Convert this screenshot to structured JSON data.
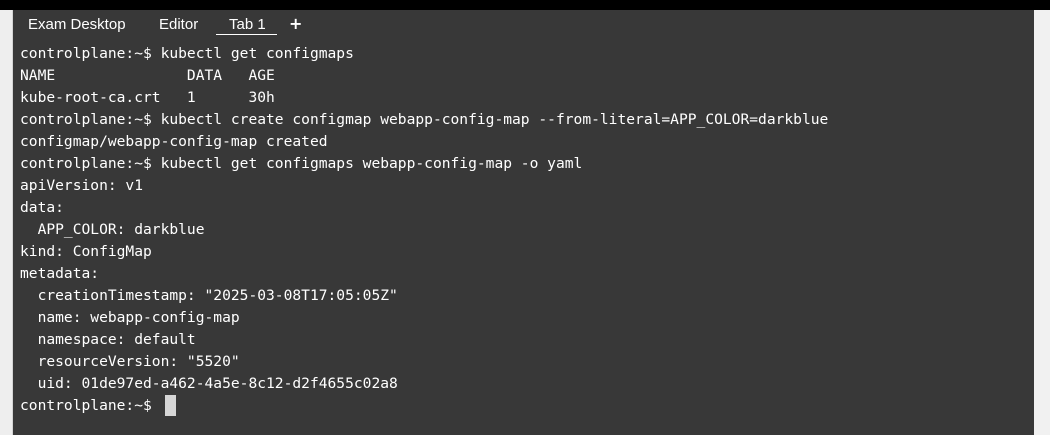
{
  "tabs": [
    {
      "label": "Exam Desktop"
    },
    {
      "label": "Editor"
    },
    {
      "label": "Tab 1"
    }
  ],
  "new_tab_label": "+",
  "terminal": {
    "lines": [
      "controlplane:~$ kubectl get configmaps",
      "NAME               DATA   AGE",
      "kube-root-ca.crt   1      30h",
      "controlplane:~$ kubectl create configmap webapp-config-map --from-literal=APP_COLOR=darkblue",
      "configmap/webapp-config-map created",
      "controlplane:~$ kubectl get configmaps webapp-config-map -o yaml",
      "apiVersion: v1",
      "data:",
      "  APP_COLOR: darkblue",
      "kind: ConfigMap",
      "metadata:",
      "  creationTimestamp: \"2025-03-08T17:05:05Z\"",
      "  name: webapp-config-map",
      "  namespace: default",
      "  resourceVersion: \"5520\"",
      "  uid: 01de97ed-a462-4a5e-8c12-d2f4655c02a8",
      "controlplane:~$ "
    ]
  },
  "colors": {
    "terminal_background": "#383838",
    "text": "#ffffff",
    "cursor": "#d6d6d6"
  }
}
